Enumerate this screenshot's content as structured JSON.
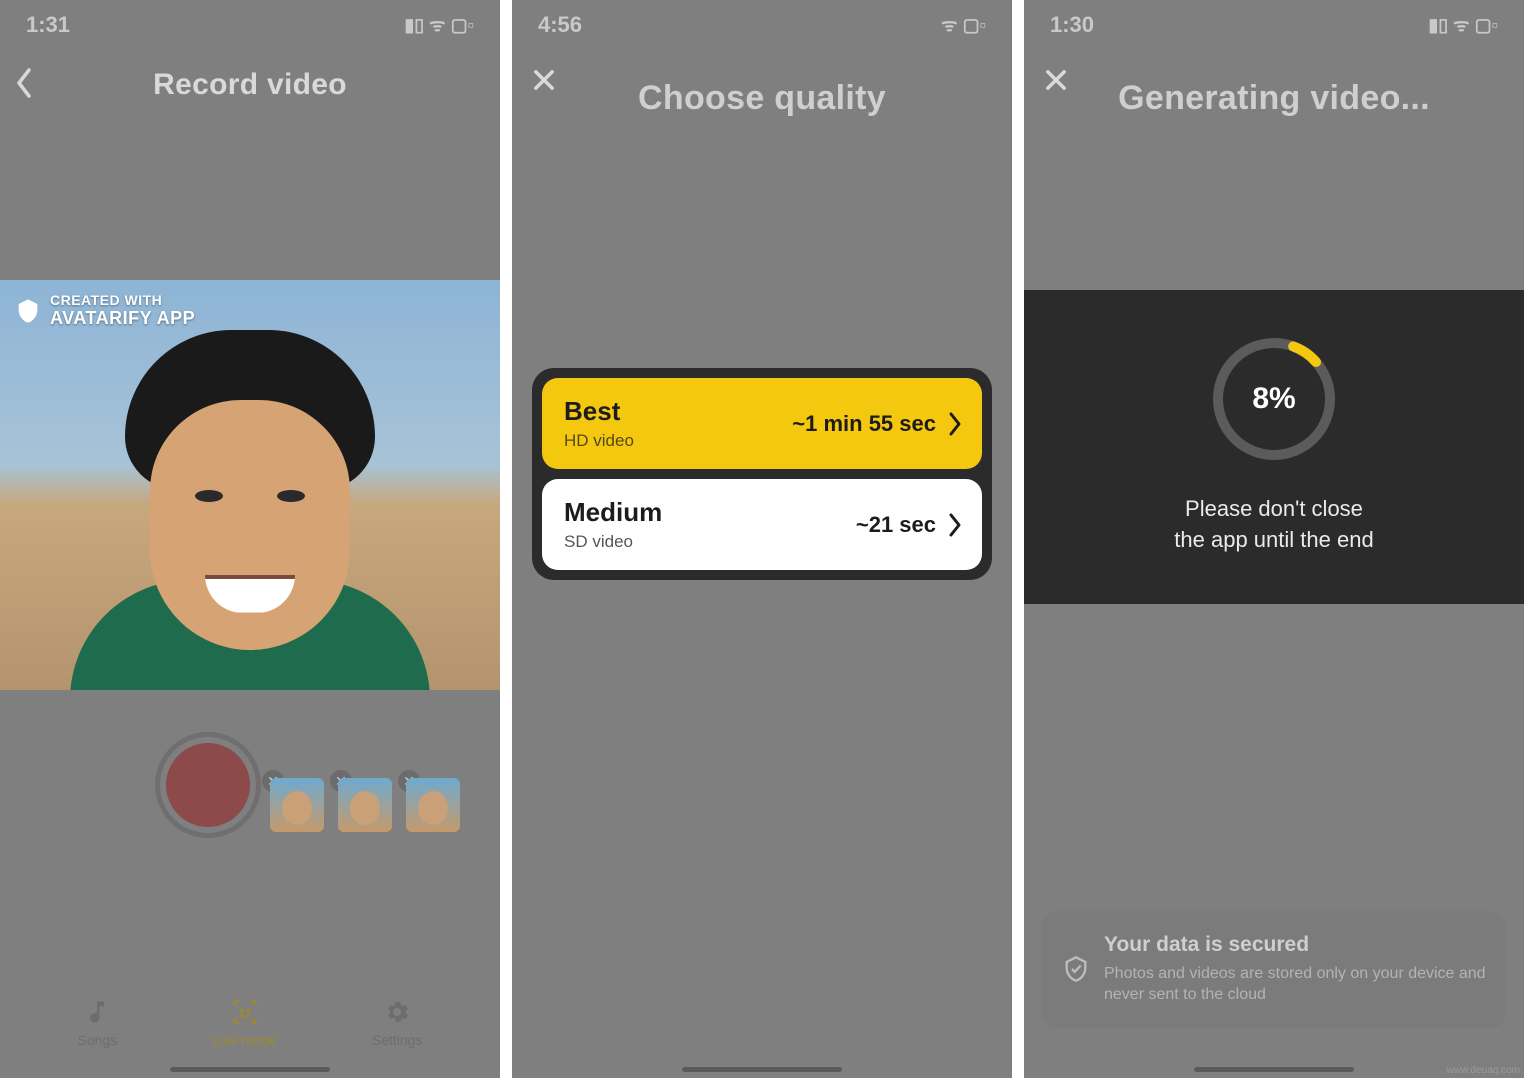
{
  "screens": [
    {
      "status": {
        "time": "1:31",
        "indicators": "▮▯  ᯤ  ▢▫"
      },
      "header": {
        "title": "Record video"
      },
      "watermark": {
        "line1": "CREATED WITH",
        "line2": "AVATARIFY APP"
      },
      "tabs": [
        {
          "label": "Songs",
          "icon": "music-note-icon",
          "active": false
        },
        {
          "label": "Live mode",
          "icon": "face-scan-icon",
          "active": true
        },
        {
          "label": "Settings",
          "icon": "gear-icon",
          "active": false
        }
      ],
      "recent_thumbs": 3
    },
    {
      "status": {
        "time": "4:56",
        "indicators": "ᯤ  ▢▫"
      },
      "header": {
        "title": "Choose quality"
      },
      "options": [
        {
          "title": "Best",
          "subtitle": "HD video",
          "time_estimate": "~1 min 55 sec",
          "variant": "primary"
        },
        {
          "title": "Medium",
          "subtitle": "SD video",
          "time_estimate": "~21 sec",
          "variant": "secondary"
        }
      ]
    },
    {
      "status": {
        "time": "1:30",
        "indicators": "▮▯  ᯤ  ▢▫"
      },
      "header": {
        "title": "Generating video..."
      },
      "progress": {
        "percent": 8,
        "label": "8%"
      },
      "message_line1": "Please don't close",
      "message_line2": "the app until the end",
      "secured": {
        "title": "Your data is secured",
        "body": "Photos and videos are stored only on your device and never sent to the cloud"
      }
    }
  ],
  "attribution": "www.deuaq.com"
}
